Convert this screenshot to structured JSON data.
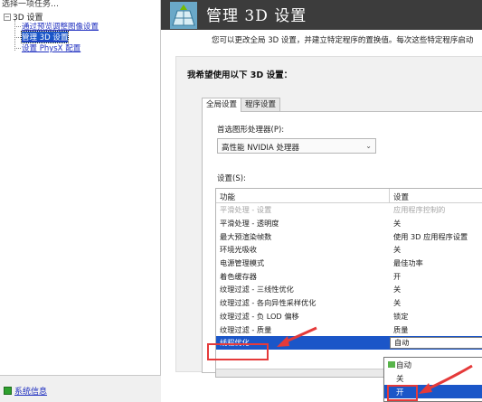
{
  "left_panel": {
    "task_header": "选择一项任务…",
    "tree_root": "3D 设置",
    "tree_root_toggle": "−",
    "tree_items": [
      {
        "label": "通过预览调整图像设置"
      },
      {
        "label": "管理 3D 设置",
        "selected": true
      },
      {
        "label": "设置 PhysX 配置"
      }
    ]
  },
  "status_bar": {
    "system_info": "系统信息"
  },
  "header": {
    "title": "管理 3D 设置",
    "intro": "您可以更改全局 3D 设置，并建立特定程序的置换值。每次这些特定程序启动"
  },
  "panel": {
    "heading": "我希望使用以下 3D 设置：",
    "tabs": [
      {
        "label": "全局设置",
        "active": true
      },
      {
        "label": "程序设置",
        "active": false
      }
    ],
    "gpu_label": "首选图形处理器(P):",
    "gpu_value": "高性能 NVIDIA 处理器",
    "settings_label": "设置(S):",
    "columns": [
      "功能",
      "设置"
    ],
    "rows": [
      {
        "feature": "平滑处理 - 设置",
        "value": "应用程序控制的",
        "disabled": true
      },
      {
        "feature": "平滑处理 - 透明度",
        "value": "关"
      },
      {
        "feature": "最大预渲染帧数",
        "value": "使用 3D 应用程序设置"
      },
      {
        "feature": "环境光吸收",
        "value": "关"
      },
      {
        "feature": "电源管理模式",
        "value": "最佳功率"
      },
      {
        "feature": "着色缓存器",
        "value": "开"
      },
      {
        "feature": "纹理过滤 - 三线性优化",
        "value": "关"
      },
      {
        "feature": "纹理过滤 - 各向异性采样优化",
        "value": "关"
      },
      {
        "feature": "纹理过滤 - 负 LOD 偏移",
        "value": "锁定"
      },
      {
        "feature": "纹理过滤 - 质量",
        "value": "质量"
      },
      {
        "feature": "线程优化",
        "value": "自动",
        "selected": true
      }
    ],
    "dropdown_options": [
      {
        "label": "自动",
        "checked": true
      },
      {
        "label": "关"
      },
      {
        "label": "开",
        "highlighted": true
      }
    ]
  },
  "colors": {
    "selection_blue": "#1b56c8",
    "annotation_red": "#e53a3a",
    "banner_dark": "#3c3c3c",
    "link_blue": "#2030c0"
  }
}
